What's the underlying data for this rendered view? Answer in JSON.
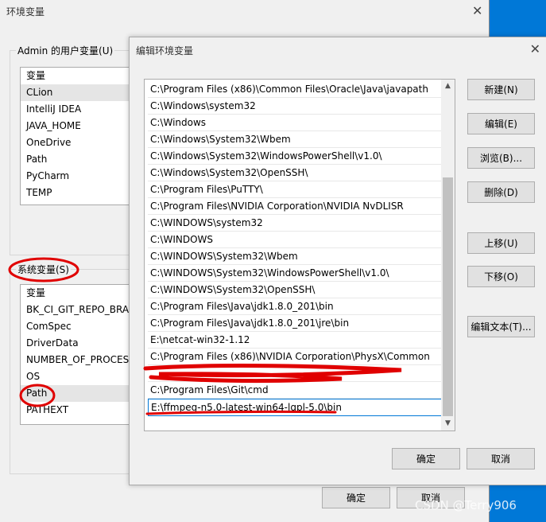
{
  "outer": {
    "title": "环境变量",
    "user_group_label": "Admin 的用户变量(U)",
    "user_vars": [
      "变量",
      "CLion",
      "IntelliJ IDEA",
      "JAVA_HOME",
      "OneDrive",
      "Path",
      "PyCharm",
      "TEMP"
    ],
    "sys_group_label": "系统变量(S)",
    "sys_vars": [
      "变量",
      "BK_CI_GIT_REPO_BRAN",
      "ComSpec",
      "DriverData",
      "NUMBER_OF_PROCESS",
      "OS",
      "Path",
      "PATHEXT"
    ],
    "ok": "确定",
    "cancel": "取消"
  },
  "dialog": {
    "title": "编辑环境变量",
    "paths": [
      "C:\\Program Files (x86)\\Common Files\\Oracle\\Java\\javapath",
      "C:\\Windows\\system32",
      "C:\\Windows",
      "C:\\Windows\\System32\\Wbem",
      "C:\\Windows\\System32\\WindowsPowerShell\\v1.0\\",
      "C:\\Windows\\System32\\OpenSSH\\",
      "C:\\Program Files\\PuTTY\\",
      "C:\\Program Files\\NVIDIA Corporation\\NVIDIA NvDLISR",
      "C:\\WINDOWS\\system32",
      "C:\\WINDOWS",
      "C:\\WINDOWS\\System32\\Wbem",
      "C:\\WINDOWS\\System32\\WindowsPowerShell\\v1.0\\",
      "C:\\WINDOWS\\System32\\OpenSSH\\",
      "C:\\Program Files\\Java\\jdk1.8.0_201\\bin",
      "C:\\Program Files\\Java\\jdk1.8.0_201\\jre\\bin",
      "E:\\netcat-win32-1.12",
      "C:\\Program Files (x86)\\NVIDIA Corporation\\PhysX\\Common",
      "",
      "C:\\Program Files\\Git\\cmd",
      "E:\\ffmpeg-n5.0-latest-win64-lgpl-5.0\\bin"
    ],
    "buttons": {
      "new": "新建(N)",
      "edit": "编辑(E)",
      "browse": "浏览(B)...",
      "delete": "删除(D)",
      "up": "上移(U)",
      "down": "下移(O)",
      "edit_text": "编辑文本(T)...",
      "ok": "确定",
      "cancel": "取消"
    }
  },
  "watermark": "CSDN @Terry906"
}
